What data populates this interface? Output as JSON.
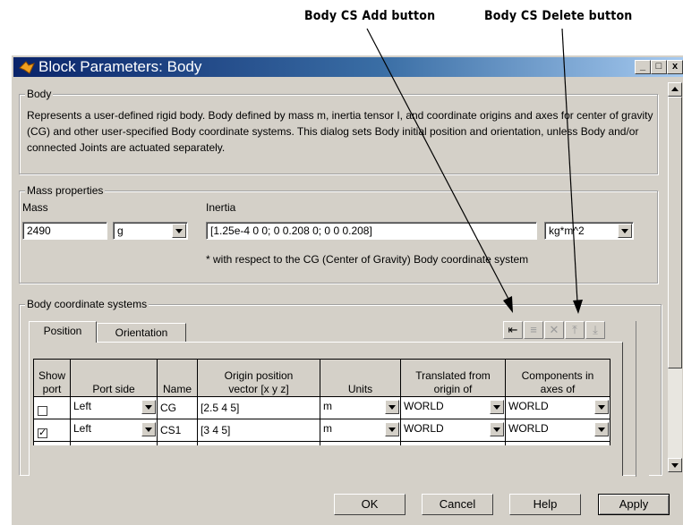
{
  "callouts": {
    "add_label": "Body CS Add button",
    "delete_label": "Body CS Delete button"
  },
  "window": {
    "title": "Block Parameters: Body",
    "controls": [
      "_",
      "□",
      "x"
    ]
  },
  "body_group": {
    "label": "Body",
    "description": "Represents a user-defined rigid body. Body defined by mass m, inertia tensor I, and coordinate origins and axes for center of gravity (CG) and other user-specified Body coordinate systems. This dialog sets Body initial position and orientation, unless Body and/or connected Joints are actuated separately."
  },
  "mass_group": {
    "label": "Mass properties",
    "mass_label": "Mass",
    "mass_value": "2490",
    "mass_unit": "g",
    "inertia_label": "Inertia",
    "inertia_value": "[1.25e-4 0 0; 0 0.208 0; 0 0 0.208]",
    "inertia_unit": "kg*m^2",
    "note": "* with respect to the CG (Center of Gravity) Body coordinate system"
  },
  "cs_group": {
    "label": "Body coordinate systems",
    "tabs": [
      "Position",
      "Orientation"
    ],
    "active_tab": "Position",
    "toolbar_icons": [
      "add-cs-icon",
      "insert-cs-icon",
      "delete-cs-icon",
      "move-up-icon",
      "move-down-icon"
    ],
    "columns": [
      [
        "Show",
        "port"
      ],
      [
        "",
        "Port side"
      ],
      [
        "",
        "Name"
      ],
      [
        "Origin position",
        "vector [x y z]"
      ],
      [
        "",
        "Units"
      ],
      [
        "Translated from",
        "origin of"
      ],
      [
        "Components in",
        "axes of"
      ]
    ],
    "rows": [
      {
        "show_port": false,
        "port_side": "Left",
        "name": "CG",
        "origin": "[2.5 4 5]",
        "units": "m",
        "translated_from": "WORLD",
        "components_in": "WORLD"
      },
      {
        "show_port": true,
        "port_side": "Left",
        "name": "CS1",
        "origin": "[3 4 5]",
        "units": "m",
        "translated_from": "WORLD",
        "components_in": "WORLD"
      }
    ]
  },
  "buttons": {
    "ok": "OK",
    "cancel": "Cancel",
    "help": "Help",
    "apply": "Apply"
  },
  "colors": {
    "titlebar_start": "#0a246a",
    "titlebar_end": "#a6caf0",
    "dialog_bg": "#d4d0c8"
  }
}
